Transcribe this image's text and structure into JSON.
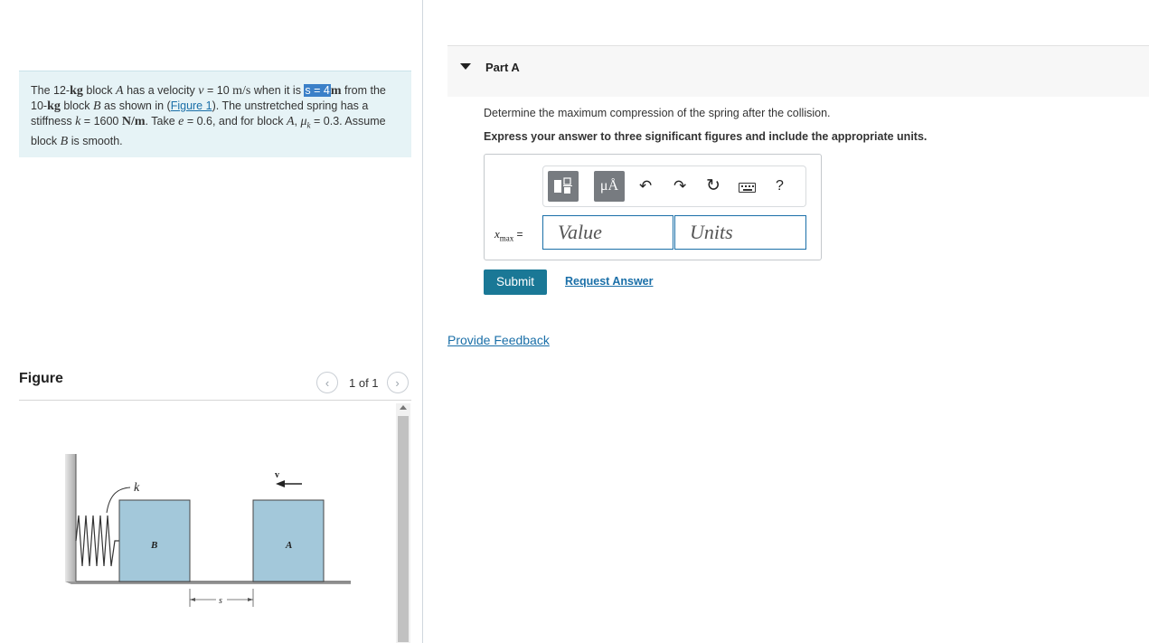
{
  "problem": {
    "t1": "The 12-",
    "kg1": "kg",
    "t2": " block ",
    "A1": "A",
    "t3": " has a velocity ",
    "v": "v",
    "t4": " = 10 ",
    "ms": "m/s",
    "t5": " when it is ",
    "s_hl": "s = 4",
    "m_unit": "m",
    "t6": " from the 10-",
    "kg2": "kg",
    "t7": " block ",
    "B1": "B",
    "t8": " as shown in (",
    "fig_link": "Figure 1",
    "t9": "). The unstretched spring has a stiffness ",
    "k": "k",
    "t10": " = 1600 ",
    "Nm": "N/m",
    "t11": ". Take ",
    "e": "e",
    "t12": " = 0.6, and for block ",
    "A2": "A",
    "t13": ", ",
    "mu": "μ",
    "muk": "k",
    "t14": " = 0.3. Assume block ",
    "B2": "B",
    "t15": " is smooth."
  },
  "figure": {
    "title": "Figure",
    "pager": "1 of 1",
    "labels": {
      "k": "k",
      "B": "B",
      "A": "A",
      "v": "v",
      "s": "s"
    },
    "colors": {
      "block": "#a3c8da",
      "wall": "#bdbdbd",
      "ground": "#888888"
    }
  },
  "part": {
    "label": "Part A",
    "question": "Determine the maximum compression of the spring after the collision.",
    "instruction": "Express your answer to three significant figures and include the appropriate units.",
    "toolbar": {
      "templates_icon": "fraction-template-icon",
      "units_label": "μÅ",
      "undo_icon": "undo-icon",
      "redo_icon": "redo-icon",
      "reset_icon": "reset-icon",
      "keyboard_icon": "keyboard-icon",
      "help": "?"
    },
    "var_main": "x",
    "var_sub": "max",
    "equals": "=",
    "value_placeholder": "Value",
    "units_placeholder": "Units",
    "submit": "Submit",
    "request": "Request Answer",
    "feedback": "Provide Feedback"
  },
  "colors": {
    "accent": "#1a7896",
    "link": "#1a6fa8",
    "problem_bg": "#e6f3f6"
  }
}
